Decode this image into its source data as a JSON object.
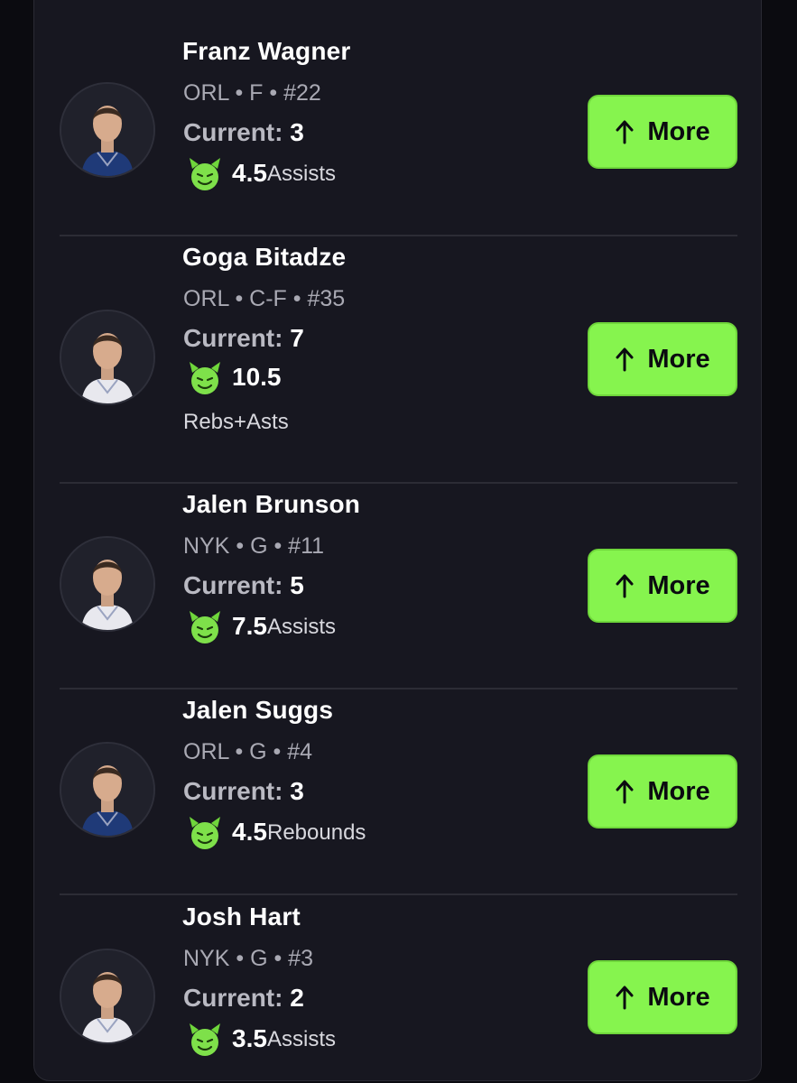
{
  "players": [
    {
      "name": "Franz Wagner",
      "team": "ORL",
      "position": "F",
      "number": "#22",
      "current_label": "Current:",
      "current_value": "3",
      "line": "4.5",
      "stat": "Assists",
      "stat_inline": true,
      "button_label": "More",
      "arrow_icon": "arrow-up-icon",
      "devil_icon": "devil-face-icon",
      "jersey_color": "#1f3a78"
    },
    {
      "name": "Goga Bitadze",
      "team": "ORL",
      "position": "C-F",
      "number": "#35",
      "current_label": "Current:",
      "current_value": "7",
      "line": "10.5",
      "stat": "Rebs+Asts",
      "stat_inline": false,
      "button_label": "More",
      "arrow_icon": "arrow-up-icon",
      "devil_icon": "devil-face-icon",
      "jersey_color": "#e8e8ee"
    },
    {
      "name": "Jalen Brunson",
      "team": "NYK",
      "position": "G",
      "number": "#11",
      "current_label": "Current:",
      "current_value": "5",
      "line": "7.5",
      "stat": "Assists",
      "stat_inline": true,
      "button_label": "More",
      "arrow_icon": "arrow-up-icon",
      "devil_icon": "devil-face-icon",
      "jersey_color": "#e8e8ee"
    },
    {
      "name": "Jalen Suggs",
      "team": "ORL",
      "position": "G",
      "number": "#4",
      "current_label": "Current:",
      "current_value": "3",
      "line": "4.5",
      "stat": "Rebounds",
      "stat_inline": true,
      "button_label": "More",
      "arrow_icon": "arrow-up-icon",
      "devil_icon": "devil-face-icon",
      "jersey_color": "#1f3a78"
    },
    {
      "name": "Josh Hart",
      "team": "NYK",
      "position": "G",
      "number": "#3",
      "current_label": "Current:",
      "current_value": "2",
      "line": "3.5",
      "stat": "Assists",
      "stat_inline": true,
      "button_label": "More",
      "arrow_icon": "arrow-up-icon",
      "devil_icon": "devil-face-icon",
      "jersey_color": "#e8e8ee"
    }
  ],
  "colors": {
    "accent_green": "#86f44e",
    "card_background": "#171720",
    "page_background": "#0b0b10"
  }
}
